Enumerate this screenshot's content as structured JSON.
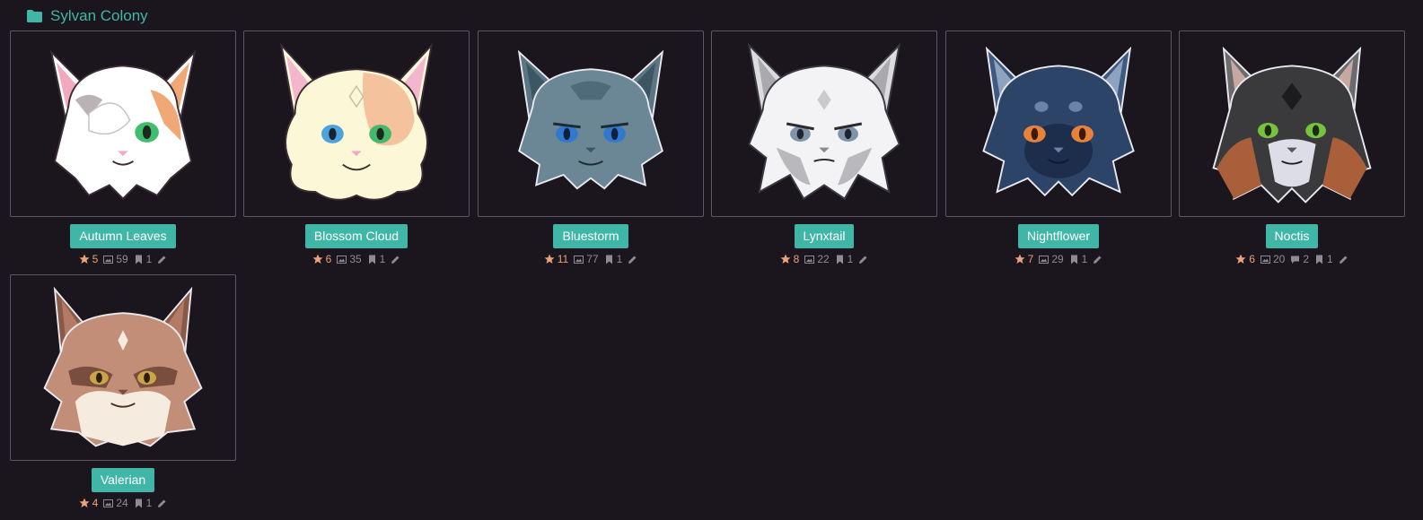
{
  "folder": {
    "title": "Sylvan Colony",
    "icon": "folder-icon"
  },
  "colors": {
    "accent": "#3fb6a6",
    "favorite": "#e9a27a",
    "muted": "#8f8b96",
    "background": "#1b161d",
    "border": "#5b5761"
  },
  "characters": [
    {
      "name": "Autumn Leaves",
      "favorites": "5",
      "images": "59",
      "comments": null,
      "bookmarks": "1"
    },
    {
      "name": "Blossom Cloud",
      "favorites": "6",
      "images": "35",
      "comments": null,
      "bookmarks": "1"
    },
    {
      "name": "Bluestorm",
      "favorites": "11",
      "images": "77",
      "comments": null,
      "bookmarks": "1"
    },
    {
      "name": "Lynxtail",
      "favorites": "8",
      "images": "22",
      "comments": null,
      "bookmarks": "1"
    },
    {
      "name": "Nightflower",
      "favorites": "7",
      "images": "29",
      "comments": null,
      "bookmarks": "1"
    },
    {
      "name": "Noctis",
      "favorites": "6",
      "images": "20",
      "comments": "2",
      "bookmarks": "1"
    },
    {
      "name": "Valerian",
      "favorites": "4",
      "images": "24",
      "comments": null,
      "bookmarks": "1"
    }
  ]
}
